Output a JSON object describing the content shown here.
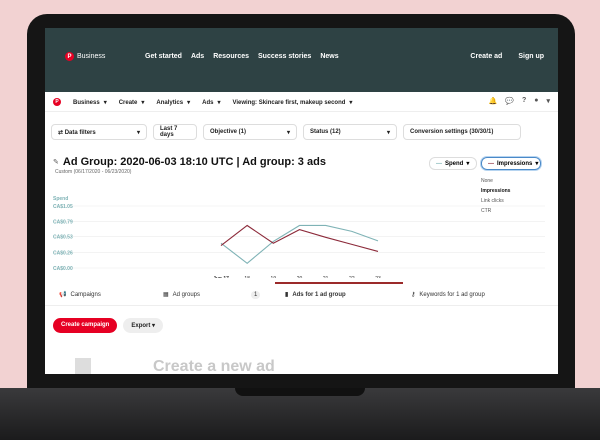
{
  "topbar": {
    "brand": "Business",
    "nav": [
      "Get started",
      "Ads",
      "Resources",
      "Success stories",
      "News"
    ],
    "create_ad": "Create ad",
    "sign_up": "Sign up"
  },
  "bizbar": {
    "items": [
      "Business",
      "Create",
      "Analytics",
      "Ads",
      "Viewing: Skincare first, makeup second"
    ]
  },
  "filters": {
    "data_filters": "Data filters",
    "date_range": "Last 7 days",
    "objective": "Objective (1)",
    "status": "Status (12)",
    "conversion": "Conversion settings (30/30/1)"
  },
  "header": {
    "title": "Ad Group: 2020-06-03 18:10 UTC | Ad group: 3 ads",
    "subtitle": "Custom (06/17/2020 - 06/23/2020)",
    "spend_btn": "Spend",
    "impressions_btn": "Impressions"
  },
  "metric_dropdown": {
    "options": [
      "None",
      "Impressions",
      "Link clicks",
      "CTR"
    ],
    "selected_index": 1
  },
  "tabs": {
    "campaigns": "Campaigns",
    "ad_groups": "Ad groups",
    "badge": "1",
    "ads": "Ads for 1 ad group",
    "keywords": "Keywords for 1 ad group"
  },
  "actions": {
    "create_campaign": "Create campaign",
    "export": "Export"
  },
  "below": {
    "create_heading": "Create a new ad"
  },
  "chart_data": {
    "type": "line",
    "ylabel": "Spend",
    "y_ticks": [
      "CA$1.05",
      "CA$0.79",
      "CA$0.53",
      "CA$0.26",
      "CA$0.00"
    ],
    "y_tick_values": [
      1.05,
      0.79,
      0.53,
      0.26,
      0
    ],
    "categories": [
      "Jun 17",
      "18",
      "19",
      "20",
      "21",
      "22",
      "23"
    ],
    "ylim": [
      0,
      1.05
    ],
    "series": [
      {
        "name": "Spend",
        "color": "#7fb3b6",
        "values": [
          0.42,
          0.08,
          0.45,
          0.72,
          0.72,
          0.62,
          0.46
        ]
      },
      {
        "name": "Impressions",
        "color": "#8c2a3a",
        "values": [
          0.38,
          0.72,
          0.42,
          0.65,
          0.52,
          0.4,
          0.28
        ]
      }
    ]
  }
}
